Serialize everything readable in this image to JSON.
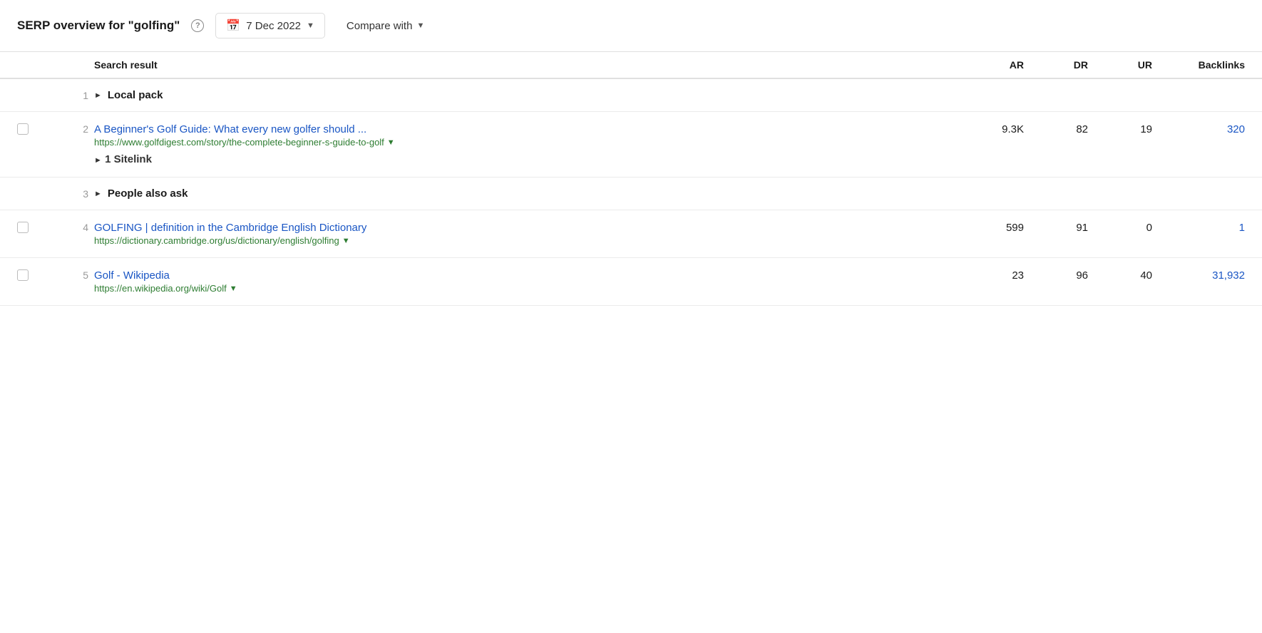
{
  "header": {
    "title": "SERP overview for \"golfing\"",
    "help_label": "?",
    "date_label": "7 Dec 2022",
    "compare_label": "Compare with"
  },
  "table": {
    "columns": {
      "search_result": "Search result",
      "ar": "AR",
      "dr": "DR",
      "ur": "UR",
      "backlinks": "Backlinks"
    },
    "rows": [
      {
        "id": "row-local-pack",
        "type": "special",
        "num": "1",
        "label": "Local pack",
        "has_checkbox": false
      },
      {
        "id": "row-2",
        "type": "result",
        "num": "2",
        "title": "A Beginner's Golf Guide: What every new golfer should ...",
        "url": "https://www.golfdigest.com/story/the-complete-beginner-s-guide-to-golf",
        "has_sitelink": true,
        "sitelink_label": "1 Sitelink",
        "ar": "9.3K",
        "dr": "82",
        "ur": "19",
        "backlinks": "320",
        "backlinks_blue": true,
        "has_checkbox": true
      },
      {
        "id": "row-people-also-ask",
        "type": "special",
        "num": "3",
        "label": "People also ask",
        "has_checkbox": false
      },
      {
        "id": "row-4",
        "type": "result",
        "num": "4",
        "title": "GOLFING | definition in the Cambridge English Dictionary",
        "url": "https://dictionary.cambridge.org/us/dictionary/english/golfing",
        "has_sitelink": false,
        "ar": "599",
        "dr": "91",
        "ur": "0",
        "backlinks": "1",
        "backlinks_blue": true,
        "has_checkbox": true
      },
      {
        "id": "row-5",
        "type": "result",
        "num": "5",
        "title": "Golf - Wikipedia",
        "url": "https://en.wikipedia.org/wiki/Golf",
        "has_sitelink": false,
        "ar": "23",
        "dr": "96",
        "ur": "40",
        "backlinks": "31,932",
        "backlinks_blue": true,
        "has_checkbox": true
      }
    ]
  }
}
